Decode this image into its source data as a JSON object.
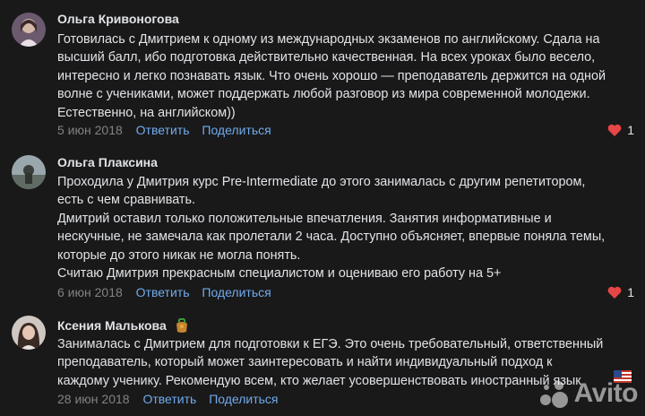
{
  "comments": [
    {
      "author": "Ольга Кривоногова",
      "text": "Готовилась с Дмитрием к одному из международных экзаменов по английскому. Сдала на\nвысший балл, ибо подготовка действительно качественная. На всех уроках было весело,\nинтересно и легко познавать язык. Что очень хорошо — преподаватель держится на одной\nволне с учениками, может поддержать любой разговор из мира современной молодежи.\nЕстественно, на английском))",
      "date": "5 июн 2018",
      "reply_label": "Ответить",
      "share_label": "Поделиться",
      "likes": "1"
    },
    {
      "author": "Ольга Плаксина",
      "text": "Проходила у Дмитрия курс Pre-Intermediate до этого занималась с другим репетитором,\nесть с чем сравнивать.\nДмитрий оставил только положительные впечатления. Занятия информативные и\nнескучные, не замечала как пролетали 2 часа. Доступно объясняет, впервые поняла темы,\nкоторые до этого никак не могла понять.\nСчитаю Дмитрия прекрасным специалистом и оцениваю его работу на 5+",
      "date": "6 июн 2018",
      "reply_label": "Ответить",
      "share_label": "Поделиться",
      "likes": "1"
    },
    {
      "author": "Ксения Малькова",
      "text": "Занималась с Дмитрием для подготовки к ЕГЭ. Это очень требовательный, ответственный\nпреподаватель, который может заинтересовать и найти индивидуальный подход к\nкаждому ученику. Рекомендую всем, кто желает усовершенствовать иностранный язык",
      "date": "28 июн 2018",
      "reply_label": "Ответить",
      "share_label": "Поделиться"
    }
  ],
  "watermark": "Avito",
  "colors": {
    "background": "#19191a",
    "link": "#71aaeb",
    "heart": "#e64646",
    "muted": "#828282"
  }
}
